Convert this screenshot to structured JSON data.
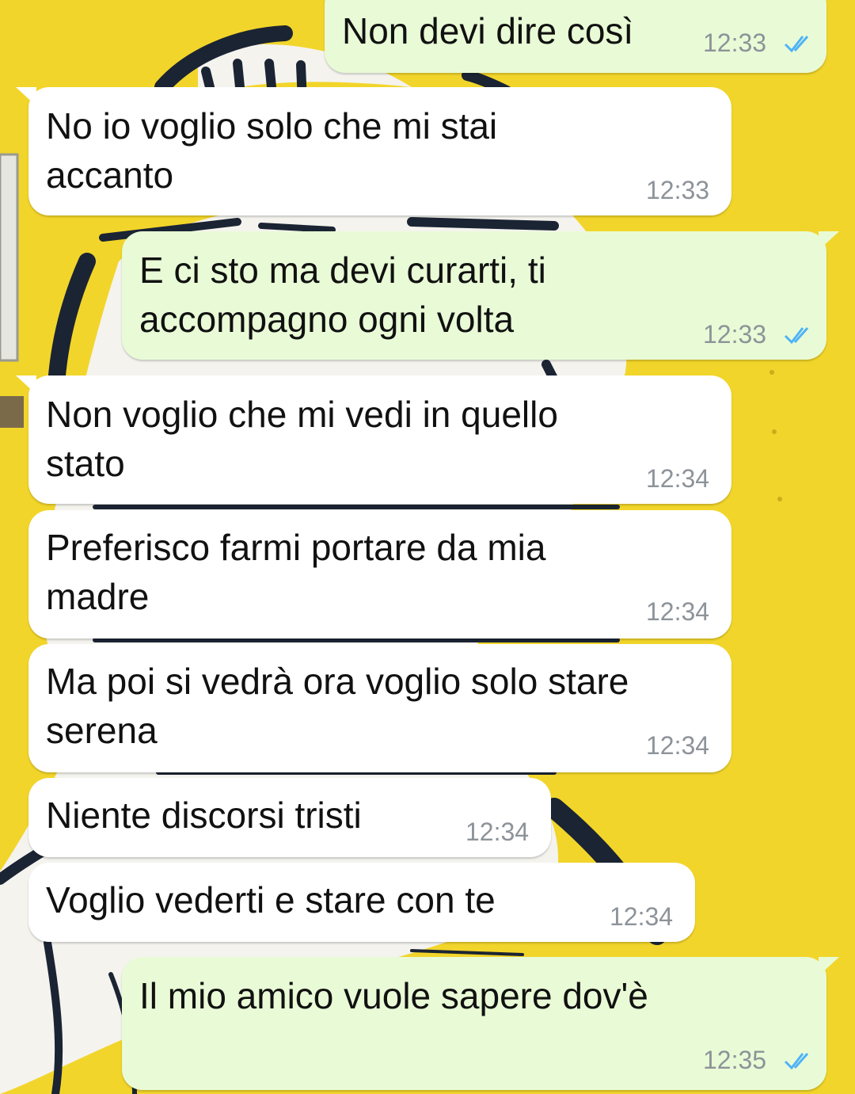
{
  "colors": {
    "wallpaper_yellow": "#f2d52a",
    "incoming_bubble": "#ffffff",
    "outgoing_bubble": "#e9fbd6",
    "timestamp_gray": "#8d9399",
    "read_ticks_blue": "#4fb3f6"
  },
  "messages": [
    {
      "direction": "outgoing",
      "text": "Non devi dire così",
      "time": "12:33",
      "status": "read-ticks-icon"
    },
    {
      "direction": "incoming",
      "text": "No io voglio solo che mi stai\naccanto",
      "time": "12:33"
    },
    {
      "direction": "outgoing",
      "text": "E ci sto ma devi curarti, ti\naccompagno ogni volta",
      "time": "12:33",
      "status": "read-ticks-icon"
    },
    {
      "direction": "incoming",
      "text": "Non voglio che mi vedi in quello\nstato",
      "time": "12:34"
    },
    {
      "direction": "incoming",
      "text": "Preferisco farmi portare da mia\nmadre",
      "time": "12:34"
    },
    {
      "direction": "incoming",
      "text": "Ma poi si vedrà ora voglio solo stare\nserena",
      "time": "12:34"
    },
    {
      "direction": "incoming",
      "text": "Niente discorsi tristi",
      "time": "12:34"
    },
    {
      "direction": "incoming",
      "text": "Voglio vederti e stare con te",
      "time": "12:34"
    },
    {
      "direction": "outgoing",
      "text": "Il mio amico vuole sapere dov'è",
      "time": "12:35",
      "status": "read-ticks-icon"
    }
  ]
}
